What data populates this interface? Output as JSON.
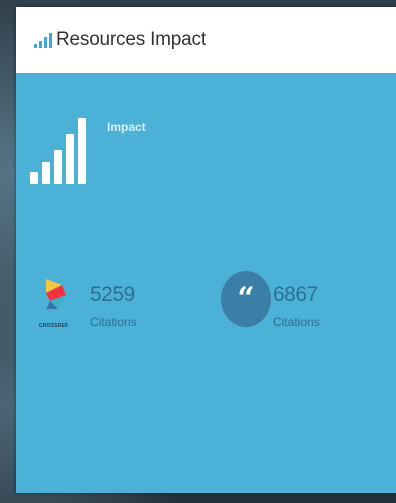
{
  "panel": {
    "title": "Resources Impact",
    "title_icon": "signal-bars-icon",
    "accent_color": "#4cb1d7"
  },
  "impact": {
    "label": "Impact",
    "icon": "signal-bars-icon"
  },
  "stats": [
    {
      "source_icon": "crossref-logo-icon",
      "logo_text": "CROSSREF",
      "value": "5259",
      "caption": "Citations"
    },
    {
      "source_icon": "quote-icon",
      "icon_glyph": "“",
      "value": "6867",
      "caption": "Citations"
    }
  ]
}
